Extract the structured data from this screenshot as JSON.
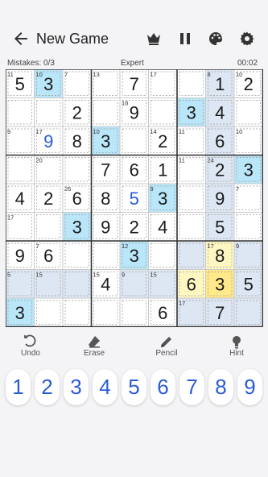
{
  "header": {
    "title": "New Game"
  },
  "status": {
    "mistakes": "Mistakes: 0/3",
    "difficulty": "Expert",
    "timer": "00:02"
  },
  "colors": {
    "accent": "#2a5bd7",
    "selected_cell": "#b9e6f8",
    "highlight": "#dde7f3",
    "same_group": "#fff7c2",
    "focus": "#ffe98a"
  },
  "tools": [
    {
      "label": "Undo",
      "icon": "undo-icon"
    },
    {
      "label": "Erase",
      "icon": "eraser-icon"
    },
    {
      "label": "Pencil",
      "icon": "pencil-icon"
    },
    {
      "label": "Hint",
      "icon": "bulb-icon"
    }
  ],
  "numbers": [
    "1",
    "2",
    "3",
    "4",
    "5",
    "6",
    "7",
    "8",
    "9"
  ],
  "grid": [
    [
      "5",
      "3",
      "",
      "",
      "7",
      "",
      "",
      "1",
      "2"
    ],
    [
      "",
      "",
      "2",
      "",
      "9",
      "",
      "3",
      "4",
      ""
    ],
    [
      "",
      "9",
      "8",
      "3",
      "",
      "2",
      "",
      "6",
      ""
    ],
    [
      "",
      "",
      "",
      "7",
      "6",
      "1",
      "",
      "2",
      "3"
    ],
    [
      "4",
      "2",
      "6",
      "8",
      "5",
      "3",
      "",
      "9",
      ""
    ],
    [
      "",
      "",
      "3",
      "9",
      "2",
      "4",
      "",
      "5",
      ""
    ],
    [
      "9",
      "6",
      "",
      "",
      "3",
      "",
      "",
      "8",
      ""
    ],
    [
      "",
      "",
      "",
      "4",
      "",
      "",
      "6",
      "3",
      "5"
    ],
    [
      "3",
      "",
      "",
      "",
      "",
      "6",
      "",
      "7",
      ""
    ]
  ],
  "cages": [
    {
      "sum": "11",
      "r": 0,
      "c": 0
    },
    {
      "sum": "10",
      "r": 0,
      "c": 1
    },
    {
      "sum": "7",
      "r": 0,
      "c": 2
    },
    {
      "sum": "13",
      "r": 0,
      "c": 3
    },
    {
      "sum": "17",
      "r": 0,
      "c": 5
    },
    {
      "sum": "8",
      "r": 0,
      "c": 7
    },
    {
      "sum": "10",
      "r": 0,
      "c": 8
    },
    {
      "sum": "18",
      "r": 1,
      "c": 4
    },
    {
      "sum": "9",
      "r": 2,
      "c": 0
    },
    {
      "sum": "17",
      "r": 2,
      "c": 1
    },
    {
      "sum": "10",
      "r": 2,
      "c": 3
    },
    {
      "sum": "14",
      "r": 2,
      "c": 5
    },
    {
      "sum": "11",
      "r": 2,
      "c": 6
    },
    {
      "sum": "10",
      "r": 2,
      "c": 8
    },
    {
      "sum": "20",
      "r": 3,
      "c": 1
    },
    {
      "sum": "11",
      "r": 3,
      "c": 6
    },
    {
      "sum": "24",
      "r": 3,
      "c": 7
    },
    {
      "sum": "26",
      "r": 4,
      "c": 2
    },
    {
      "sum": "9",
      "r": 4,
      "c": 5
    },
    {
      "sum": "7",
      "r": 4,
      "c": 8
    },
    {
      "sum": "17",
      "r": 5,
      "c": 0
    },
    {
      "sum": "7",
      "r": 6,
      "c": 1
    },
    {
      "sum": "12",
      "r": 6,
      "c": 4
    },
    {
      "sum": "17",
      "r": 6,
      "c": 7
    },
    {
      "sum": "9",
      "r": 6,
      "c": 8
    },
    {
      "sum": "5",
      "r": 7,
      "c": 0
    },
    {
      "sum": "15",
      "r": 7,
      "c": 1
    },
    {
      "sum": "15",
      "r": 7,
      "c": 3
    },
    {
      "sum": "9",
      "r": 7,
      "c": 4
    },
    {
      "sum": "15",
      "r": 7,
      "c": 5
    },
    {
      "sum": "17",
      "r": 8,
      "c": 6
    }
  ]
}
